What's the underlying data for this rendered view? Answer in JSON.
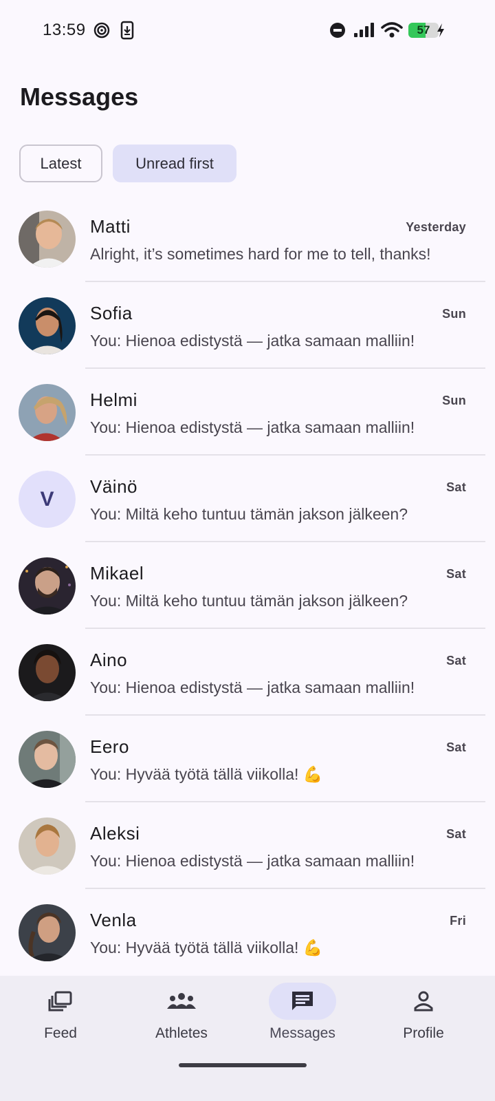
{
  "status_bar": {
    "time": "13:59",
    "battery_level": "57",
    "battery_fraction": 0.57,
    "icons": [
      "target-icon",
      "download-phone-icon",
      "do-not-disturb-icon",
      "signal-icon",
      "wifi-icon",
      "battery-icon",
      "charging-icon"
    ]
  },
  "header": {
    "title": "Messages"
  },
  "filters": {
    "latest": "Latest",
    "unread_first": "Unread first",
    "active": "unread_first"
  },
  "messages": [
    {
      "name": "Matti",
      "time": "Yesterday",
      "preview": "Alright, it’s sometimes hard for me to tell, thanks!",
      "avatar": "photo"
    },
    {
      "name": "Sofia",
      "time": "Sun",
      "preview": "You: Hienoa edistystä — jatka samaan malliin!",
      "avatar": "photo"
    },
    {
      "name": "Helmi",
      "time": "Sun",
      "preview": "You: Hienoa edistystä — jatka samaan malliin!",
      "avatar": "photo"
    },
    {
      "name": "Väinö",
      "time": "Sat",
      "preview": "You: Miltä keho tuntuu tämän jakson jälkeen?",
      "avatar": "letter",
      "initial": "V"
    },
    {
      "name": "Mikael",
      "time": "Sat",
      "preview": "You: Miltä keho tuntuu tämän jakson jälkeen?",
      "avatar": "photo"
    },
    {
      "name": "Aino",
      "time": "Sat",
      "preview": "You: Hienoa edistystä — jatka samaan malliin!",
      "avatar": "photo"
    },
    {
      "name": "Eero",
      "time": "Sat",
      "preview": "You: Hyvää työtä tällä viikolla! 💪",
      "avatar": "photo"
    },
    {
      "name": "Aleksi",
      "time": "Sat",
      "preview": "You: Hienoa edistystä — jatka samaan malliin!",
      "avatar": "photo"
    },
    {
      "name": "Venla",
      "time": "Fri",
      "preview": "You: Hyvää työtä tällä viikolla! 💪",
      "avatar": "photo"
    }
  ],
  "bottom_nav": {
    "items": [
      {
        "label": "Feed",
        "icon": "feed-icon"
      },
      {
        "label": "Athletes",
        "icon": "group-icon"
      },
      {
        "label": "Messages",
        "icon": "message-icon",
        "active": true
      },
      {
        "label": "Profile",
        "icon": "person-icon"
      }
    ]
  },
  "colors": {
    "background": "#fbf8fe",
    "chip_active": "#e0e0f8",
    "nav_background": "#efedf4",
    "letter_avatar_bg": "#e2e0fb",
    "letter_avatar_fg": "#3c3a78"
  }
}
